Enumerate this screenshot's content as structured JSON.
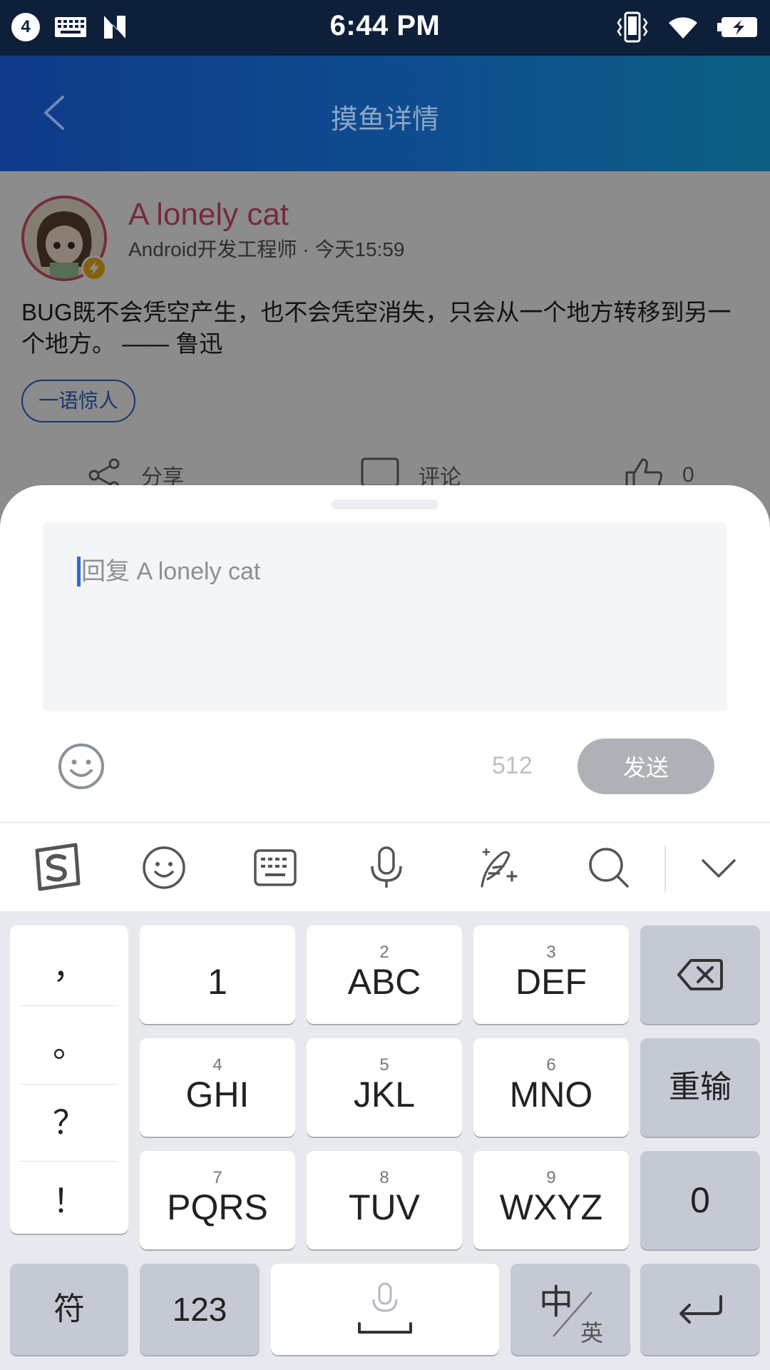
{
  "status_bar": {
    "notification_count": "4",
    "time": "6:44 PM"
  },
  "header": {
    "title": "摸鱼详情"
  },
  "post": {
    "author_name": "A lonely cat",
    "author_meta": "Android开发工程师 · 今天15:59",
    "content": "BUG既不会凭空产生，也不会凭空消失，只会从一个地方转移到另一个地方。 —— 鲁迅",
    "topic_tag": "一语惊人",
    "actions": {
      "share": "分享",
      "comment": "评论",
      "like_count": "0"
    }
  },
  "reply_sheet": {
    "placeholder": "回复 A lonely cat",
    "char_count": "512",
    "send_label": "发送"
  },
  "keyboard": {
    "toolbar_icons": [
      "sogou-logo-icon",
      "emoji-icon",
      "keyboard-icon",
      "microphone-icon",
      "handwriting-icon",
      "search-icon",
      "collapse-chevron-icon"
    ],
    "punctuation": [
      "，",
      "。",
      "？",
      "！"
    ],
    "rows": [
      [
        {
          "num": "",
          "main": "1"
        },
        {
          "num": "2",
          "main": "ABC"
        },
        {
          "num": "3",
          "main": "DEF"
        }
      ],
      [
        {
          "num": "4",
          "main": "GHI"
        },
        {
          "num": "5",
          "main": "JKL"
        },
        {
          "num": "6",
          "main": "MNO"
        }
      ],
      [
        {
          "num": "7",
          "main": "PQRS"
        },
        {
          "num": "8",
          "main": "TUV"
        },
        {
          "num": "9",
          "main": "WXYZ"
        }
      ]
    ],
    "reset_label": "重输",
    "zero_label": "0",
    "symbol_label": "符",
    "numeric_label": "123",
    "lang_zh": "中",
    "lang_en": "英"
  },
  "colors": {
    "accent_blue": "#2a64c4",
    "author_pink": "#d6506e",
    "send_disabled": "#aeb1b6"
  }
}
